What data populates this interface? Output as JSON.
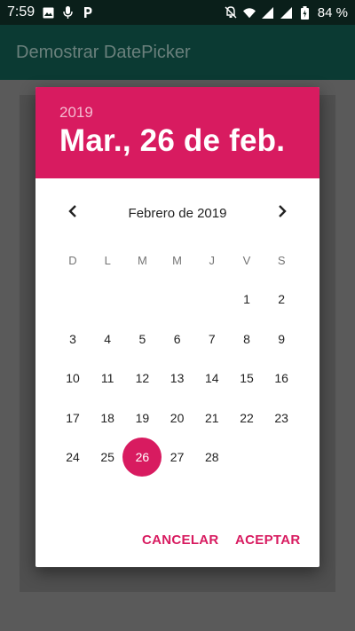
{
  "status_bar": {
    "time": "7:59",
    "battery": "84 %",
    "icons_left": [
      "image-icon",
      "mic-icon",
      "p-icon"
    ],
    "icons_right": [
      "bell-off-icon",
      "wifi-icon",
      "signal-icon",
      "signal-icon",
      "battery-icon"
    ]
  },
  "app_bar": {
    "title": "Demostrar DatePicker"
  },
  "dialog": {
    "year": "2019",
    "selected_date": "Mar., 26 de feb.",
    "month_label": "Febrero de 2019",
    "weekdays": [
      "D",
      "L",
      "M",
      "M",
      "J",
      "V",
      "S"
    ],
    "first_weekday_index": 5,
    "days": [
      "1",
      "2",
      "3",
      "4",
      "5",
      "6",
      "7",
      "8",
      "9",
      "10",
      "11",
      "12",
      "13",
      "14",
      "15",
      "16",
      "17",
      "18",
      "19",
      "20",
      "21",
      "22",
      "23",
      "24",
      "25",
      "26",
      "27",
      "28"
    ],
    "selected_day": "26",
    "cancel_label": "CANCELAR",
    "accept_label": "ACEPTAR"
  },
  "colors": {
    "accent": "#d81b60",
    "app_bar": "#0b3a33",
    "status_bar": "#0a1f1a"
  }
}
